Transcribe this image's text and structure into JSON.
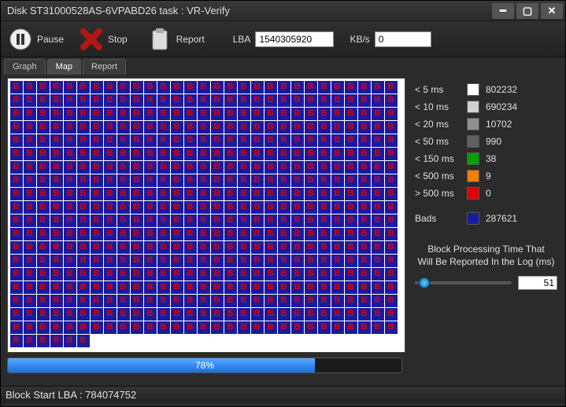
{
  "window": {
    "title": "Disk ST31000528AS-6VPABD26   task : VR-Verify"
  },
  "toolbar": {
    "pause_label": "Pause",
    "stop_label": "Stop",
    "report_label": "Report",
    "lba_label": "LBA",
    "lba_value": "1540305920",
    "kbs_label": "KB/s",
    "kbs_value": "0"
  },
  "tabs": {
    "graph": "Graph",
    "map": "Map",
    "report": "Report",
    "active": "map"
  },
  "map": {
    "block_letter": "B",
    "rows": 20,
    "cols": 29,
    "last_row_filled": 6
  },
  "legend": {
    "items": [
      {
        "label": "< 5 ms",
        "color": "#ffffff",
        "value": "802232"
      },
      {
        "label": "< 10 ms",
        "color": "#d0d0d0",
        "value": "690234"
      },
      {
        "label": "< 20 ms",
        "color": "#909090",
        "value": "10702"
      },
      {
        "label": "< 50 ms",
        "color": "#606060",
        "value": "990"
      },
      {
        "label": "< 150 ms",
        "color": "#00a000",
        "value": "38"
      },
      {
        "label": "< 500 ms",
        "color": "#f08000",
        "value": "9"
      },
      {
        "label": "> 500 ms",
        "color": "#e00000",
        "value": "0"
      }
    ],
    "bads": {
      "label": "Bads",
      "color": "#1a1aa0",
      "value": "287621"
    }
  },
  "slider": {
    "caption_line1": "Block Processing Time That",
    "caption_line2": "Will Be Reported In the Log (ms)",
    "value": "51",
    "position_pct": 4
  },
  "progress": {
    "percent": 78,
    "text": "78%"
  },
  "status": {
    "text": "Block Start LBA : 784074752"
  }
}
